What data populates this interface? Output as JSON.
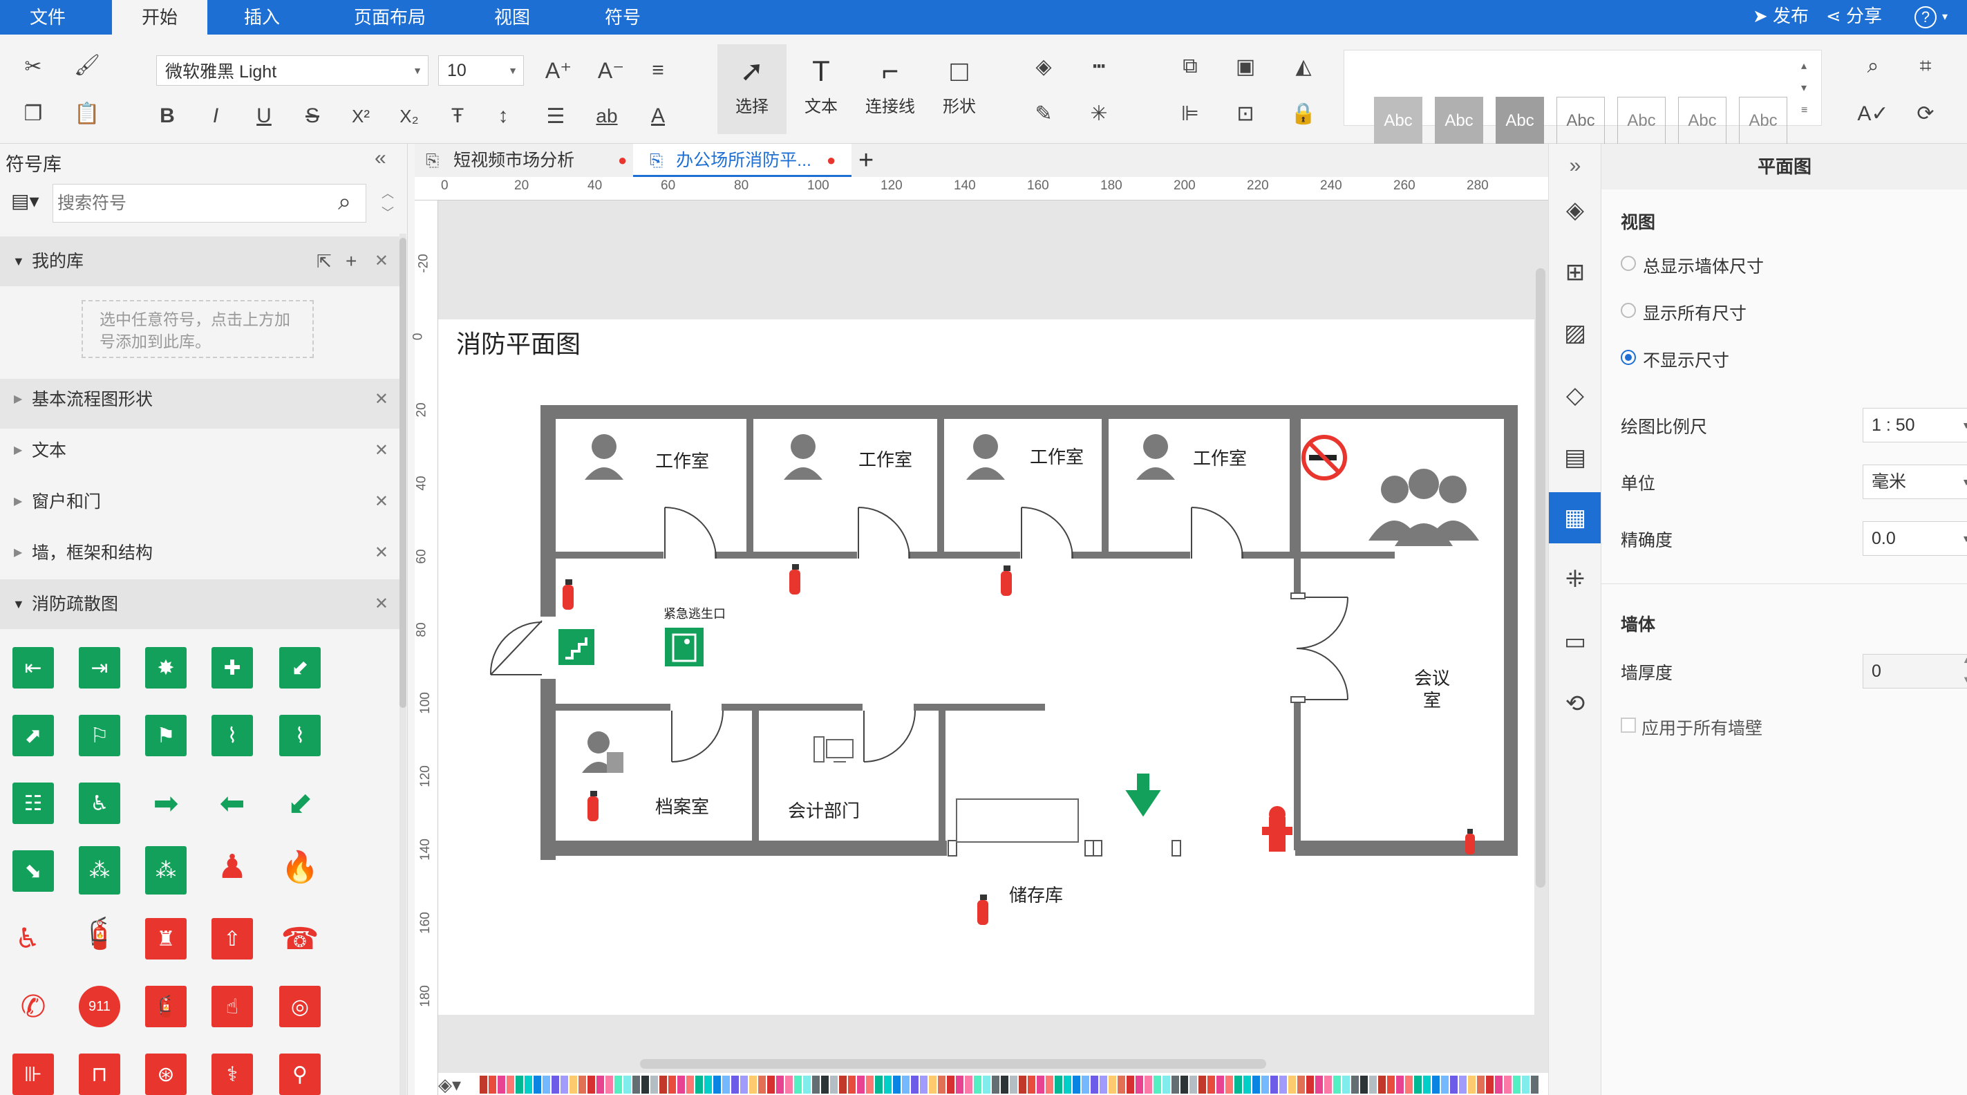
{
  "menubar": {
    "items": [
      "文件",
      "开始",
      "插入",
      "页面布局",
      "视图",
      "符号"
    ],
    "active": "开始",
    "publish": "发布",
    "share": "分享",
    "help": "?"
  },
  "ribbon": {
    "font_name": "微软雅黑 Light",
    "font_size": "10",
    "tools": {
      "select": "选择",
      "text": "文本",
      "connector": "连接线",
      "shape": "形状"
    },
    "style_samples": [
      "Abc",
      "Abc",
      "Abc",
      "Abc",
      "Abc",
      "Abc",
      "Abc"
    ]
  },
  "library": {
    "title": "符号库",
    "search_placeholder": "搜索符号",
    "my_library": "我的库",
    "my_library_hint": "选中任意符号，点击上方加号添加到此库。",
    "sections": [
      "基本流程图形状",
      "文本",
      "窗户和门",
      "墙，框架和结构",
      "消防疏散图"
    ]
  },
  "tabs": {
    "doc1": "短视频市场分析",
    "doc2": "办公场所消防平..."
  },
  "ruler": {
    "h_labels": [
      "0",
      "20",
      "40",
      "60",
      "80",
      "100",
      "120",
      "140",
      "160",
      "180",
      "200",
      "220",
      "240",
      "260",
      "280"
    ],
    "v_labels": [
      "-20",
      "0",
      "20",
      "40",
      "60",
      "80",
      "100",
      "120",
      "140",
      "160",
      "180"
    ]
  },
  "floorplan": {
    "title": "消防平面图",
    "rooms": {
      "studio1": "工作室",
      "studio2": "工作室",
      "studio3": "工作室",
      "studio4": "工作室",
      "meeting": "会议室",
      "archive": "档案室",
      "accounting": "会计部门",
      "storage": "储存库",
      "exit": "紧急逃生口"
    }
  },
  "props": {
    "title": "平面图",
    "view_section": "视图",
    "options": [
      "总显示墙体尺寸",
      "显示所有尺寸",
      "不显示尺寸"
    ],
    "selected_option": "不显示尺寸",
    "scale_label": "绘图比例尺",
    "scale_value": "1 : 50",
    "unit_label": "单位",
    "unit_value": "毫米",
    "precision_label": "精确度",
    "precision_value": "0.0",
    "wall_section": "墙体",
    "wall_thickness_label": "墙厚度",
    "wall_thickness_value": "0",
    "apply_all_label": "应用于所有墙壁"
  },
  "colors": {
    "accent": "#1e6fd4",
    "wall": "#757575",
    "exit_green": "#12a05a",
    "fire_red": "#e8352e"
  }
}
